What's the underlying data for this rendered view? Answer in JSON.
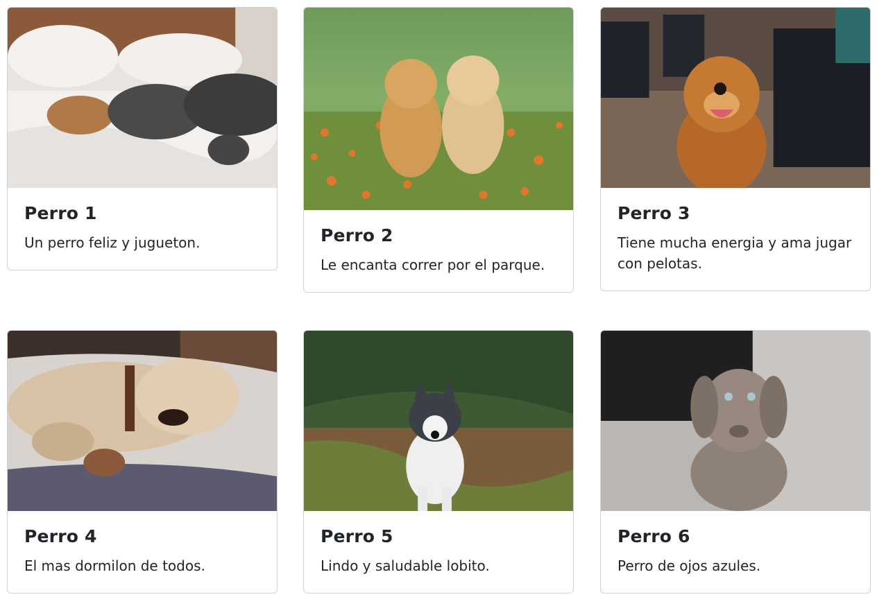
{
  "cards": [
    {
      "title": "Perro 1",
      "text": "Un perro feliz y jugueton."
    },
    {
      "title": "Perro 2",
      "text": "Le encanta correr por el parque."
    },
    {
      "title": "Perro 3",
      "text": "Tiene mucha energia y ama jugar con pelotas."
    },
    {
      "title": "Perro 4",
      "text": "El mas dormilon de todos."
    },
    {
      "title": "Perro 5",
      "text": "Lindo y saludable lobito."
    },
    {
      "title": "Perro 6",
      "text": "Perro de ojos azules."
    }
  ]
}
